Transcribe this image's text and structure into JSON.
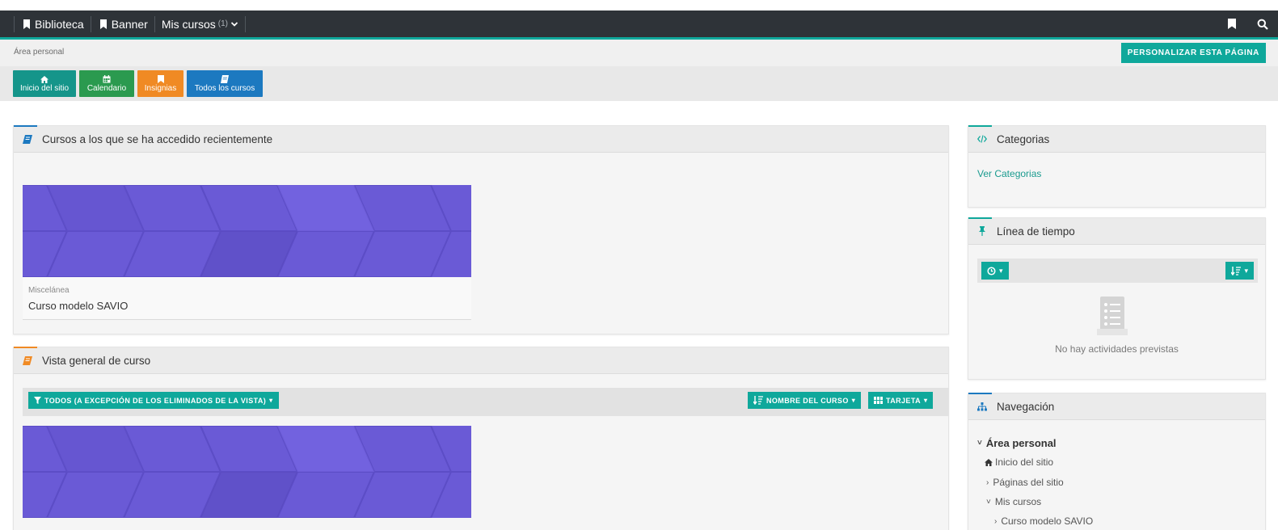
{
  "navbar": {
    "items": [
      {
        "label": "Biblioteca",
        "icon": "bookmark-icon"
      },
      {
        "label": "Banner",
        "icon": "bookmark-icon"
      },
      {
        "label": "Mis cursos",
        "count": "(1)",
        "icon": "chevron-down-icon"
      }
    ],
    "right_icons": [
      "bookmark-icon",
      "search-icon"
    ]
  },
  "breadcrumb": "Área personal",
  "customize_button": "PERSONALIZAR ESTA PÁGINA",
  "quick_links": [
    {
      "label": "Inicio del sitio",
      "icon": "home-icon",
      "color": "#15958a"
    },
    {
      "label": "Calendario",
      "icon": "calendar-icon",
      "color": "#2b9a4f"
    },
    {
      "label": "Insignias",
      "icon": "bookmark-icon",
      "color": "#f08a24"
    },
    {
      "label": "Todos los cursos",
      "icon": "book-icon",
      "color": "#1c79c0"
    }
  ],
  "recent_courses": {
    "title": "Cursos a los que se ha accedido recientemente",
    "course": {
      "category": "Miscelánea",
      "name": "Curso modelo SAVIO"
    }
  },
  "overview": {
    "title": "Vista general de curso",
    "filter_label": "TODOS (A EXCEPCIÓN DE LOS ELIMINADOS DE LA VISTA)",
    "sort_label": "NOMBRE DEL CURSO",
    "view_label": "TARJETA"
  },
  "categories": {
    "title": "Categorias",
    "link": "Ver Categorias"
  },
  "timeline": {
    "title": "Línea de tiempo",
    "empty": "No hay actividades previstas"
  },
  "navigation": {
    "title": "Navegación",
    "items": [
      {
        "label": "Área personal",
        "chevron": "˅",
        "bold": true
      },
      {
        "label": "Inicio del sitio",
        "icon": "home-icon"
      },
      {
        "label": "Páginas del sitio",
        "chevron": "›"
      },
      {
        "label": "Mis cursos",
        "chevron": "˅"
      },
      {
        "label": "Curso modelo SAVIO",
        "chevron": "›"
      }
    ]
  },
  "colors": {
    "accent": "#0fa89b",
    "navbar": "#2e3338",
    "course_image": "#6a5ad6"
  }
}
